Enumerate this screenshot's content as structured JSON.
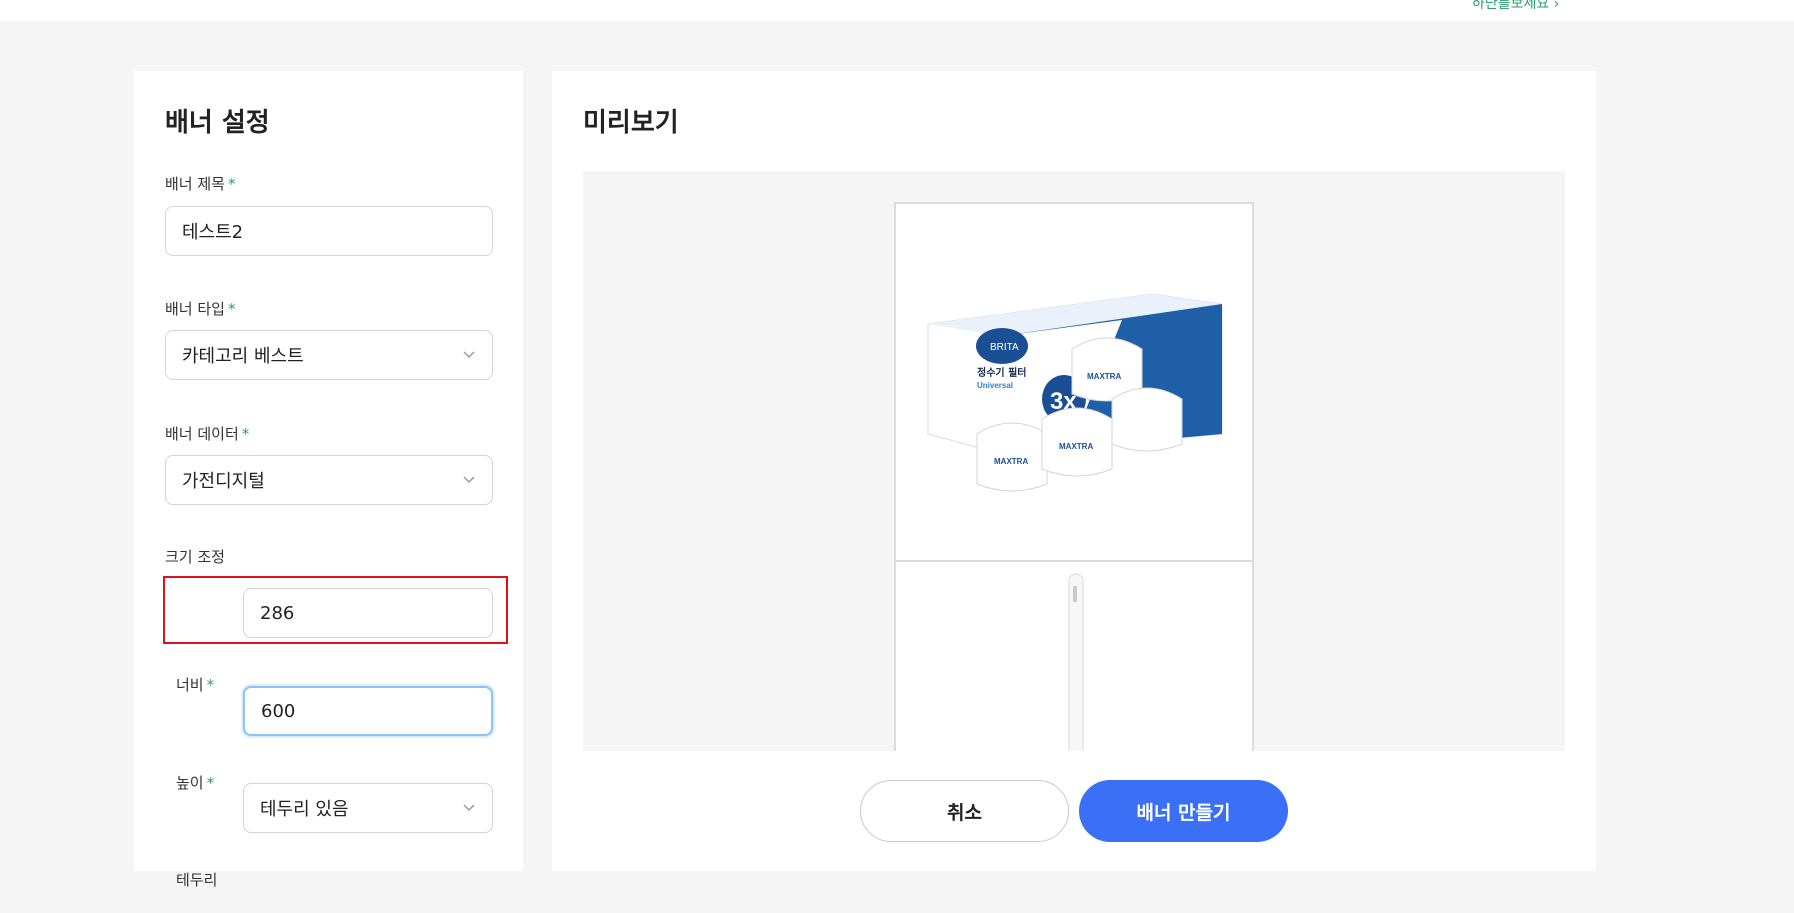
{
  "topbar": {
    "link_text": "하단를보세요 ›"
  },
  "settings": {
    "title": "배너 설정",
    "required_mark": "*",
    "banner_title": {
      "label": "배너 제목",
      "value": "테스트2"
    },
    "banner_type": {
      "label": "배너 타입",
      "value": "카테고리 베스트"
    },
    "banner_data": {
      "label": "배너 데이터",
      "value": "가전디지털"
    },
    "size_section_label": "크기 조정",
    "width": {
      "label": "너비",
      "value": "286"
    },
    "height": {
      "label": "높이",
      "value": "600"
    },
    "border": {
      "label": "테두리",
      "value": "테두리 있음"
    }
  },
  "preview": {
    "title": "미리보기",
    "product_brand": "BRITA",
    "product_name": "정수기 필터",
    "product_sub": "Universal",
    "product_count": "3x",
    "product_line": "MAXTRA"
  },
  "actions": {
    "cancel_label": "취소",
    "create_label": "배너 만들기"
  },
  "colors": {
    "accent_green": "#2e9e6a",
    "primary_blue": "#3b6ff5",
    "highlight_red": "#e0101d"
  }
}
